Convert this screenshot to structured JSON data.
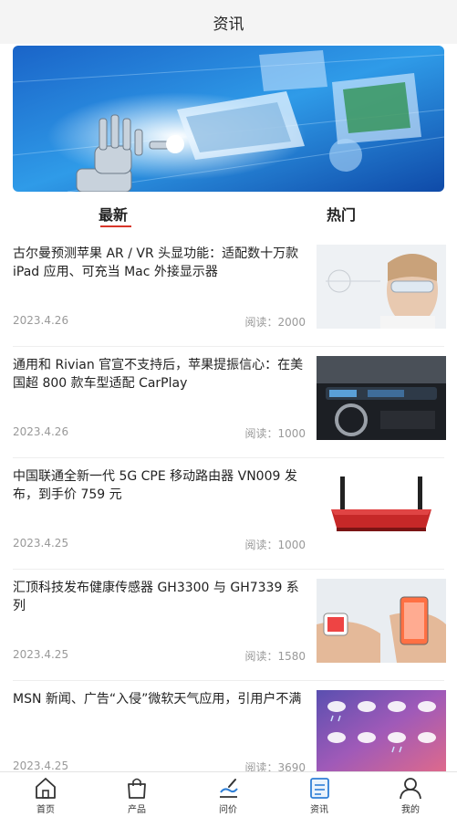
{
  "header": {
    "title": "资讯"
  },
  "tabs": [
    {
      "label": "最新",
      "active": true
    },
    {
      "label": "热门",
      "active": false
    }
  ],
  "news": [
    {
      "headline": "古尔曼预测苹果 AR / VR 头显功能：适配数十万款 iPad 应用、可充当 Mac 外接显示器",
      "date": "2023.4.26",
      "reads": "阅读：2000",
      "thumb_icon": "vr-headset-woman-image"
    },
    {
      "headline": "通用和 Rivian 官宣不支持后，苹果提振信心：在美国超 800 款车型适配 CarPlay",
      "date": "2023.4.26",
      "reads": "阅读：1000",
      "thumb_icon": "car-dashboard-image"
    },
    {
      "headline": "中国联通全新一代 5G CPE 移动路由器 VN009 发布，到手价 759 元",
      "date": "2023.4.25",
      "reads": "阅读：1000",
      "thumb_icon": "red-router-image"
    },
    {
      "headline": "汇顶科技发布健康传感器 GH3300 与 GH7339 系列",
      "date": "2023.4.25",
      "reads": "阅读：1580",
      "thumb_icon": "smartwatch-phone-image"
    },
    {
      "headline": "MSN 新闻、广告“入侵”微软天气应用，引用户不满",
      "date": "2023.4.25",
      "reads": "阅读：3690",
      "thumb_icon": "weather-icons-image"
    }
  ],
  "bottom_nav": [
    {
      "label": "首页",
      "icon": "home-icon",
      "active": false
    },
    {
      "label": "产品",
      "icon": "shopping-bag-icon",
      "active": false
    },
    {
      "label": "问价",
      "icon": "price-inquiry-icon",
      "active": false
    },
    {
      "label": "资讯",
      "icon": "news-icon",
      "active": true
    },
    {
      "label": "我的",
      "icon": "user-icon",
      "active": false
    }
  ],
  "colors": {
    "accent": "#d8362a",
    "nav_blue": "#2f7fd6",
    "muted_text": "#999999"
  }
}
